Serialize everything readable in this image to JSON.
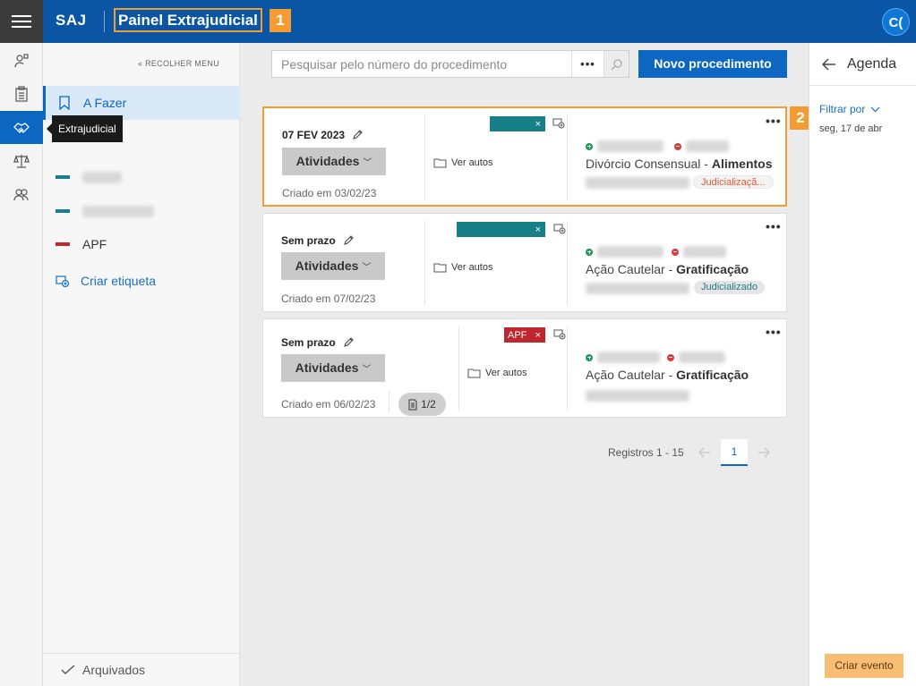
{
  "header": {
    "brand": "SAJ",
    "app_title": "Painel Extrajudicial",
    "avatar_initials": "C(",
    "annotation_1": "1",
    "annotation_2": "2"
  },
  "rail": {
    "tooltip": "Extrajudicial",
    "icons": [
      "person-settings-icon",
      "clipboard-icon",
      "handshake-icon",
      "scales-icon",
      "people-icon"
    ]
  },
  "sidebar": {
    "collapse_label": "RECOLHER MENU",
    "items": [
      {
        "label": "A Fazer"
      },
      {
        "label": "APF"
      }
    ],
    "create_tag_label": "Criar etiqueta",
    "archived_label": "Arquivados"
  },
  "search": {
    "placeholder": "Pesquisar pelo número do procedimento",
    "more_label": "•••",
    "new_button": "Novo procedimento"
  },
  "cards": [
    {
      "date": "07 FEV 2023",
      "activities": "Atividades",
      "created": "Criado em 03/02/23",
      "ver_autos": "Ver autos",
      "title_prefix": "Divórcio Consensual - ",
      "title_bold": "Alimentos",
      "status": "Judicializaçã..."
    },
    {
      "date": "Sem prazo",
      "activities": "Atividades",
      "created": "Criado em 07/02/23",
      "ver_autos": "Ver autos",
      "title_prefix": "Ação Cautelar - ",
      "title_bold": "Gratificação",
      "status": "Judicializado"
    },
    {
      "date": "Sem prazo",
      "activities": "Atividades",
      "created": "Criado em 06/02/23",
      "ver_autos": "Ver autos",
      "tag": "APF",
      "title_prefix": "Ação Cautelar - ",
      "title_bold": "Gratificação",
      "pages": "1/2"
    }
  ],
  "pagination": {
    "records": "Registros 1 - 15",
    "current_page": "1"
  },
  "agenda": {
    "title": "Agenda",
    "filter_label": "Filtrar por",
    "date": "seg, 17 de abr",
    "create_event": "Criar evento"
  },
  "colors": {
    "header_blue": "#0b56a4",
    "accent_blue": "#0b67c2",
    "highlight_orange": "#f39c33",
    "tag_teal": "#177f87",
    "tag_red": "#c0262d"
  }
}
